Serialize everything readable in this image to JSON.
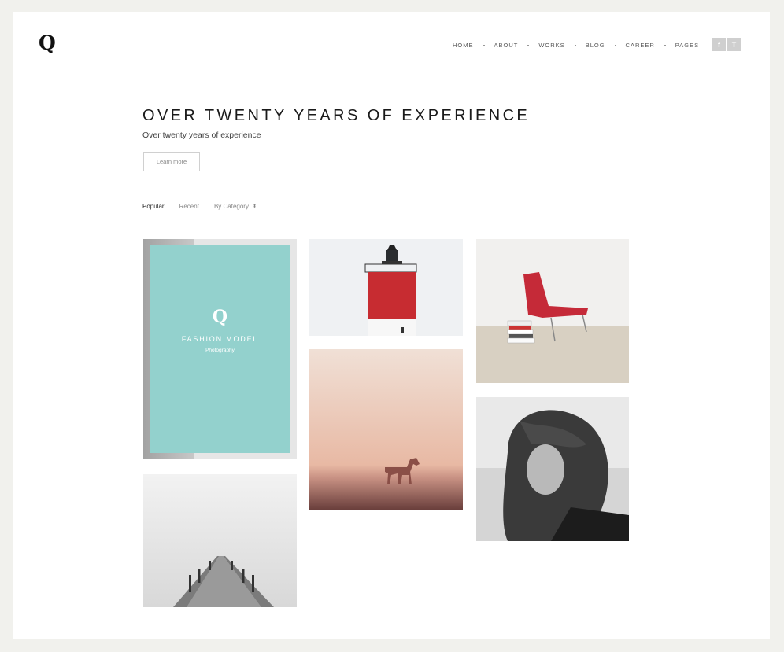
{
  "logo": "Q",
  "nav": {
    "items": [
      "HOME",
      "ABOUT",
      "WORKS",
      "BLOG",
      "CAREER",
      "PAGES"
    ]
  },
  "social": {
    "facebook": "f",
    "twitter": "T"
  },
  "hero": {
    "title": "OVER TWENTY YEARS OF EXPERIENCE",
    "subtitle": "Over twenty years of experience",
    "button": "Learn more"
  },
  "filters": {
    "popular": "Popular",
    "recent": "Recent",
    "category": "By Category",
    "category_caret": "⬍"
  },
  "gallery": {
    "fashion": {
      "logo": "Q",
      "title": "FASHION MODEL",
      "subtitle": "Photography"
    },
    "accent": "#93d1cd",
    "tiles": [
      "fashion-model",
      "lighthouse",
      "red-chair",
      "horse-desert",
      "woman-portrait",
      "pier"
    ]
  }
}
